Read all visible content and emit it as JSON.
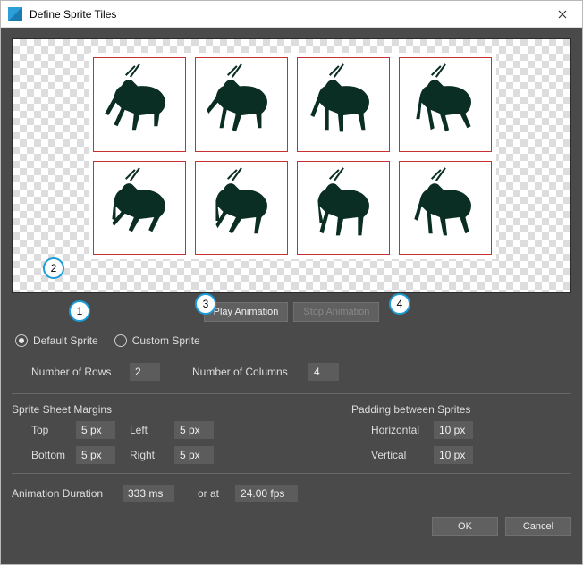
{
  "window": {
    "title": "Define Sprite Tiles"
  },
  "sprite_preview": {
    "rows": 2,
    "cols": 4,
    "tile_border_color": "#c93030",
    "sprite_fill": "#0a2e24"
  },
  "badges": {
    "b1": "1",
    "b2": "2",
    "b3": "3",
    "b4": "4"
  },
  "buttons": {
    "play": "Play Animation",
    "stop": "Stop Animation",
    "ok": "OK",
    "cancel": "Cancel"
  },
  "radios": {
    "default": "Default Sprite",
    "custom": "Custom Sprite",
    "selected": "default"
  },
  "grid": {
    "rows_label": "Number of Rows",
    "rows_value": "2",
    "cols_label": "Number of Columns",
    "cols_value": "4"
  },
  "sections": {
    "margins": "Sprite Sheet Margins",
    "padding": "Padding between Sprites"
  },
  "margins": {
    "top_label": "Top",
    "top_value": "5 px",
    "bottom_label": "Bottom",
    "bottom_value": "5 px",
    "left_label": "Left",
    "left_value": "5 px",
    "right_label": "Right",
    "right_value": "5 px"
  },
  "padding": {
    "h_label": "Horizontal",
    "h_value": "10 px",
    "v_label": "Vertical",
    "v_value": "10 px"
  },
  "duration": {
    "label": "Animation Duration",
    "value": "333 ms",
    "or_at": "or at",
    "fps_value": "24.00 fps"
  }
}
